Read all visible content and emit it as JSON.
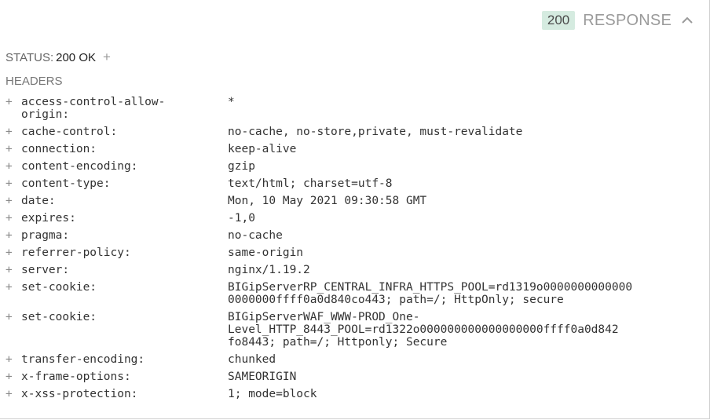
{
  "response": {
    "code": "200",
    "title": "RESPONSE"
  },
  "status": {
    "label": "STATUS:",
    "value": "200 OK",
    "add": "+"
  },
  "headers_label": "HEADERS",
  "headers": [
    {
      "key": "access-control-allow-\norigin:",
      "value": "*"
    },
    {
      "key": "cache-control:",
      "value": "no-cache, no-store,private, must-revalidate"
    },
    {
      "key": "connection:",
      "value": "keep-alive"
    },
    {
      "key": "content-encoding:",
      "value": "gzip"
    },
    {
      "key": "content-type:",
      "value": "text/html; charset=utf-8"
    },
    {
      "key": "date:",
      "value": "Mon, 10 May 2021 09:30:58 GMT"
    },
    {
      "key": "expires:",
      "value": "-1,0"
    },
    {
      "key": "pragma:",
      "value": "no-cache"
    },
    {
      "key": "referrer-policy:",
      "value": "same-origin"
    },
    {
      "key": "server:",
      "value": "nginx/1.19.2"
    },
    {
      "key": "set-cookie:",
      "value": "BIGipServerRP_CENTRAL_INFRA_HTTPS_POOL=rd1319o0000000000000\n0000000ffff0a0d840co443; path=/; HttpOnly; secure"
    },
    {
      "key": "set-cookie:",
      "value": "BIGipServerWAF_WWW-PROD_One-\nLevel_HTTP_8443_POOL=rd1322o000000000000000000ffff0a0d842\nfo8443; path=/; Httponly; Secure"
    },
    {
      "key": "transfer-encoding:",
      "value": "chunked"
    },
    {
      "key": "x-frame-options:",
      "value": "SAMEORIGIN"
    },
    {
      "key": "x-xss-protection:",
      "value": "1; mode=block"
    }
  ],
  "row_add": "+"
}
